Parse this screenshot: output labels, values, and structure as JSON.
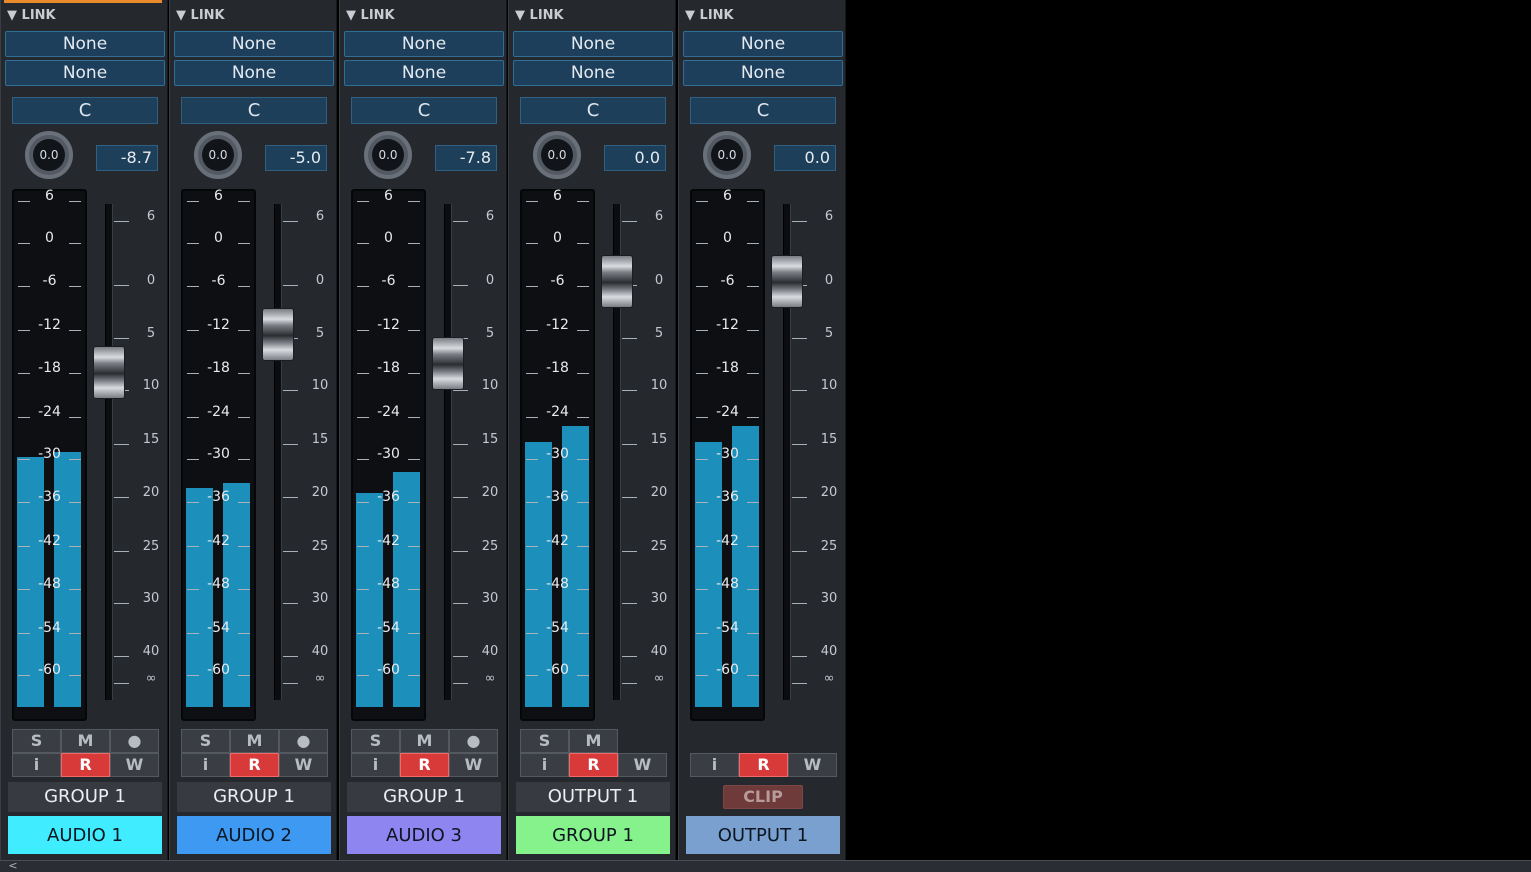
{
  "link_label": "LINK",
  "meter_scale": [
    "6",
    "0",
    "-6",
    "-12",
    "-18",
    "-24",
    "-30",
    "-36",
    "-42",
    "-48",
    "-54",
    "-60"
  ],
  "fader_scale": [
    "6",
    "0",
    "5",
    "10",
    "15",
    "20",
    "25",
    "30",
    "40",
    "∞"
  ],
  "buttons": {
    "solo": "S",
    "mute": "M",
    "record": "●",
    "input": "i",
    "read": "R",
    "write": "W",
    "clip": "CLIP"
  },
  "channels": [
    {
      "link1": "None",
      "link2": "None",
      "pan": "C",
      "knob": "0.0",
      "volume": "-8.7",
      "routing": "GROUP 1",
      "name": "AUDIO 1",
      "name_color": "#40ecff",
      "meter_levels": [
        0.49,
        0.5
      ],
      "fader_db": -8.7,
      "row_buttons": [
        "solo",
        "mute",
        "record"
      ],
      "has_clip": false,
      "selected": true
    },
    {
      "link1": "None",
      "link2": "None",
      "pan": "C",
      "knob": "0.0",
      "volume": "-5.0",
      "routing": "GROUP 1",
      "name": "AUDIO 2",
      "name_color": "#3e99f3",
      "meter_levels": [
        0.43,
        0.44
      ],
      "fader_db": -5.0,
      "row_buttons": [
        "solo",
        "mute",
        "record"
      ],
      "has_clip": false,
      "selected": false
    },
    {
      "link1": "None",
      "link2": "None",
      "pan": "C",
      "knob": "0.0",
      "volume": "-7.8",
      "routing": "GROUP 1",
      "name": "AUDIO 3",
      "name_color": "#8f85f0",
      "meter_levels": [
        0.42,
        0.46
      ],
      "fader_db": -7.8,
      "row_buttons": [
        "solo",
        "mute",
        "record"
      ],
      "has_clip": false,
      "selected": false
    },
    {
      "link1": "None",
      "link2": "None",
      "pan": "C",
      "knob": "0.0",
      "volume": "0.0",
      "routing": "OUTPUT 1",
      "name": "GROUP 1",
      "name_color": "#86f28b",
      "meter_levels": [
        0.52,
        0.55
      ],
      "fader_db": 0.0,
      "row_buttons": [
        "solo",
        "mute"
      ],
      "has_clip": false,
      "selected": false
    },
    {
      "link1": "None",
      "link2": "None",
      "pan": "C",
      "knob": "0.0",
      "volume": "0.0",
      "routing": "",
      "name": "OUTPUT 1",
      "name_color": "#7aa0cf",
      "meter_levels": [
        0.52,
        0.55
      ],
      "fader_db": 0.0,
      "row_buttons": [],
      "has_clip": true,
      "selected": false
    }
  ]
}
